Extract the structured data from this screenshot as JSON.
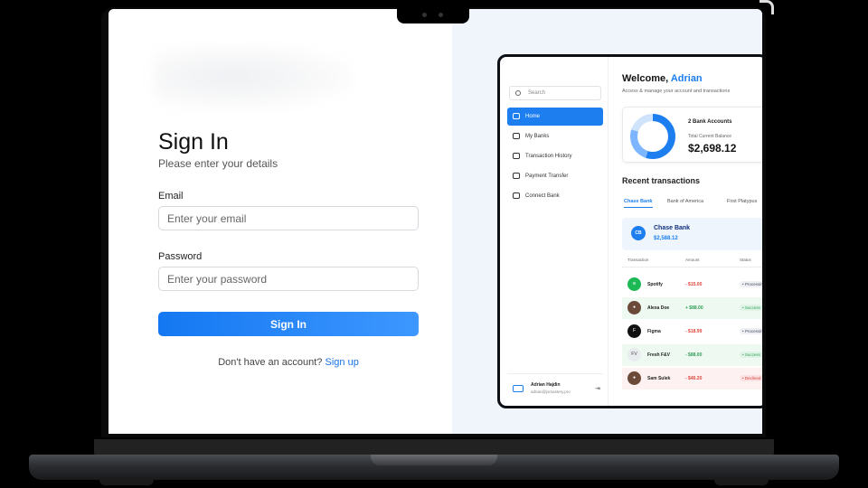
{
  "signin": {
    "title": "Sign In",
    "subtitle": "Please enter your details",
    "email_label": "Email",
    "email_placeholder": "Enter your email",
    "password_label": "Password",
    "password_placeholder": "Enter your password",
    "submit_label": "Sign In",
    "signup_prompt": "Don't have an account?",
    "signup_link": "Sign up"
  },
  "preview": {
    "search_placeholder": "Search",
    "nav": [
      {
        "label": "Home",
        "active": true
      },
      {
        "label": "My Banks",
        "active": false
      },
      {
        "label": "Transaction History",
        "active": false
      },
      {
        "label": "Payment Transfer",
        "active": false
      },
      {
        "label": "Connect Bank",
        "active": false
      }
    ],
    "user": {
      "name": "Adrian Hajdin",
      "email": "adrian@jsmastery.pro"
    },
    "welcome_prefix": "Welcome,",
    "welcome_name": "Adrian",
    "access_text": "Access & manage your account and transactions",
    "accounts_label": "2 Bank Accounts",
    "balance_label": "Total Current Balance",
    "balance_value": "$2,698.12",
    "recent_title": "Recent transactions",
    "tabs": [
      "Chase Bank",
      "Bank of America",
      "First Platypus"
    ],
    "bank_card": {
      "initials": "CB",
      "name": "Chase Bank",
      "balance": "$2,588.12"
    },
    "table_headers": [
      "Transaction",
      "Amount",
      "Status"
    ],
    "transactions": [
      {
        "icon": "spotify-icon",
        "initials": "",
        "name": "Spotify",
        "amount": "- $15.00",
        "status": "Processing",
        "type": "debit"
      },
      {
        "icon": "avatar-icon",
        "initials": "",
        "name": "Alexa Doe",
        "amount": "+ $88.00",
        "status": "Success",
        "type": "credit"
      },
      {
        "icon": "figma-icon",
        "initials": "",
        "name": "Figma",
        "amount": "- $18.99",
        "status": "Processing",
        "type": "debit"
      },
      {
        "icon": "initials-icon",
        "initials": "FV",
        "name": "Fresh F&V",
        "amount": "- $88.00",
        "status": "Success",
        "type": "credit"
      },
      {
        "icon": "avatar-icon",
        "initials": "",
        "name": "Sam Sulek",
        "amount": "- $40.20",
        "status": "Declined",
        "type": "declined"
      }
    ]
  },
  "colors": {
    "accent": "#1d7ef0",
    "button_gradient_start": "#1478f2",
    "button_gradient_end": "#3d97ff",
    "right_pane_bg": "#f0f5fc"
  }
}
